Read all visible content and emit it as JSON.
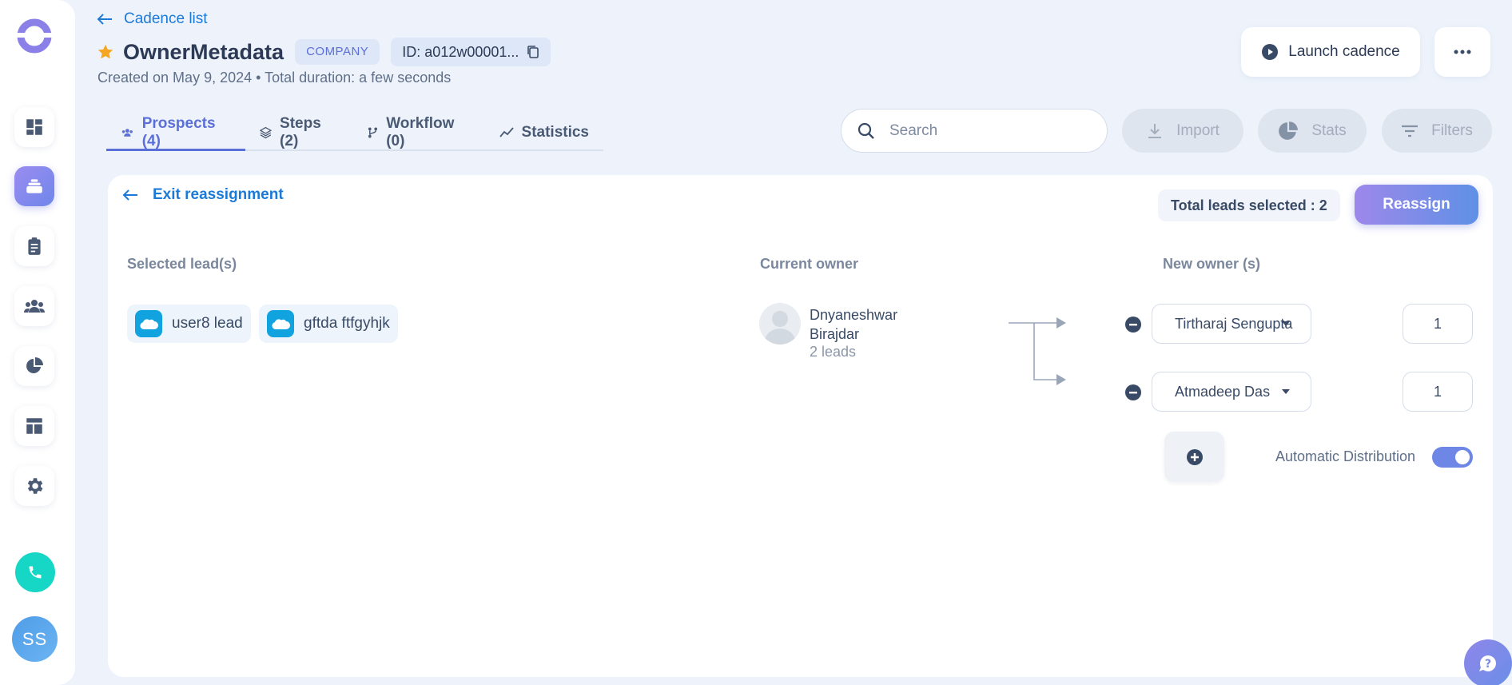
{
  "header": {
    "back_label": "Cadence list",
    "title": "OwnerMetadata",
    "badge": "COMPANY",
    "id_text": "ID: a012w00001...",
    "subtitle": "Created on May 9, 2024 • Total duration: a few seconds",
    "launch_label": "Launch cadence"
  },
  "tabs": [
    {
      "label": "Prospects (4)",
      "icon": "people-icon",
      "active": true
    },
    {
      "label": "Steps (2)",
      "icon": "layers-icon",
      "active": false
    },
    {
      "label": "Workflow (0)",
      "icon": "branch-icon",
      "active": false
    },
    {
      "label": "Statistics",
      "icon": "trend-icon",
      "active": false
    }
  ],
  "toolbar": {
    "search_placeholder": "Search",
    "import_label": "Import",
    "stats_label": "Stats",
    "filters_label": "Filters"
  },
  "reassignment": {
    "exit_label": "Exit reassignment",
    "total_selected": "Total leads selected : 2",
    "reassign_label": "Reassign",
    "selected_heading": "Selected lead(s)",
    "current_owner_heading": "Current owner",
    "new_owner_heading": "New owner (s)",
    "leads": [
      "user8 lead",
      "gftda ftfgyhjk"
    ],
    "current_owner": {
      "name": "Dnyaneshwar Birajdar",
      "leads": "2 leads"
    },
    "new_owners": [
      {
        "name": "Tirtharaj Sengupta",
        "count": "1"
      },
      {
        "name": "Atmadeep Das",
        "count": "1"
      }
    ],
    "auto_distribution_label": "Automatic Distribution",
    "auto_distribution_on": true
  },
  "user": {
    "initials": "SS"
  },
  "colors": {
    "accent": "#5b6fd8",
    "link": "#1b7ad8",
    "star": "#f5a623",
    "salesforce": "#10a3e0",
    "phone": "#16d6c6"
  }
}
